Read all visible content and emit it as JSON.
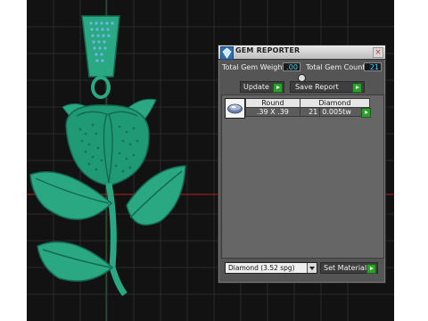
{
  "panel": {
    "title": "GEM REPORTER",
    "close_glyph": "×",
    "total_gem_weight_label": "Total Gem Weight",
    "total_gem_weight_value": ".00",
    "total_gem_count_label": "Total Gem Count",
    "total_gem_count_value": "21",
    "update_label": "Update",
    "save_report_label": "Save Report",
    "table": {
      "headers": [
        "Round",
        "Diamond"
      ],
      "row": {
        "size": ".39 X .39",
        "count": "21",
        "weight": "0.005tw"
      }
    },
    "material_select": {
      "selected": "Diamond    (3.52 spg)"
    },
    "set_material_label": "Set Material"
  },
  "icons": {
    "app": "gem-reporter-app-icon",
    "go": "green-arrow-go-icon",
    "stone": "round-stone-thumbnail-icon"
  },
  "colors": {
    "viewport_bg": "#121212",
    "model_green": "#2aa882",
    "gem_blue": "#6fb6e8",
    "value_text": "#3fd0ff",
    "go_green": "#2ca02c",
    "panel_bg": "#555555"
  }
}
